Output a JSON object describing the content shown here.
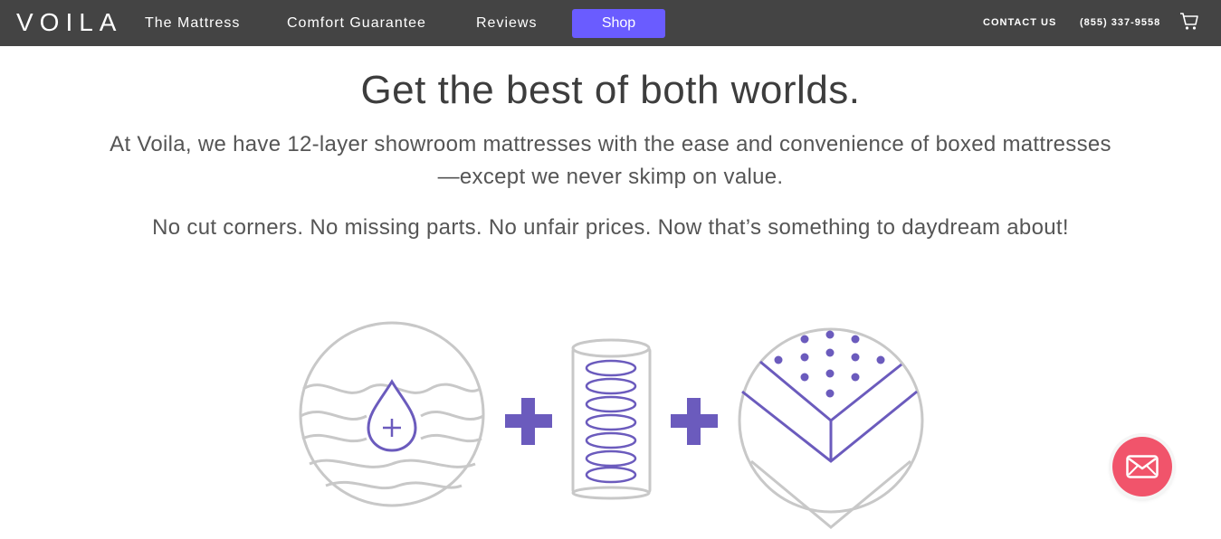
{
  "brand": {
    "logo_text": "VOILA"
  },
  "nav": {
    "links": [
      "The Mattress",
      "Comfort Guarantee",
      "Reviews"
    ],
    "shop_label": "Shop",
    "contact_label": "CONTACT US",
    "phone": "(855) 337-9558",
    "cart_icon": "cart-icon"
  },
  "hero": {
    "headline": "Get the best of both worlds.",
    "paragraph": "At Voila, we have 12-layer showroom mattresses with the ease and convenience of boxed mattresses—except we never skimp on value.",
    "tagline": "No cut corners. No missing parts. No unfair prices. Now that’s something to daydream about!"
  },
  "illustration": {
    "icons": [
      "water-drop-layers-icon",
      "plus-icon",
      "coil-spring-icon",
      "plus-icon",
      "foam-layer-icon"
    ]
  },
  "colors": {
    "nav_bg": "#444444",
    "accent": "#6a5cff",
    "illustration_purple": "#6b5bbd",
    "illustration_gray": "#c8c8c8",
    "fab": "#f1546b"
  },
  "chat": {
    "icon": "mail-icon"
  }
}
